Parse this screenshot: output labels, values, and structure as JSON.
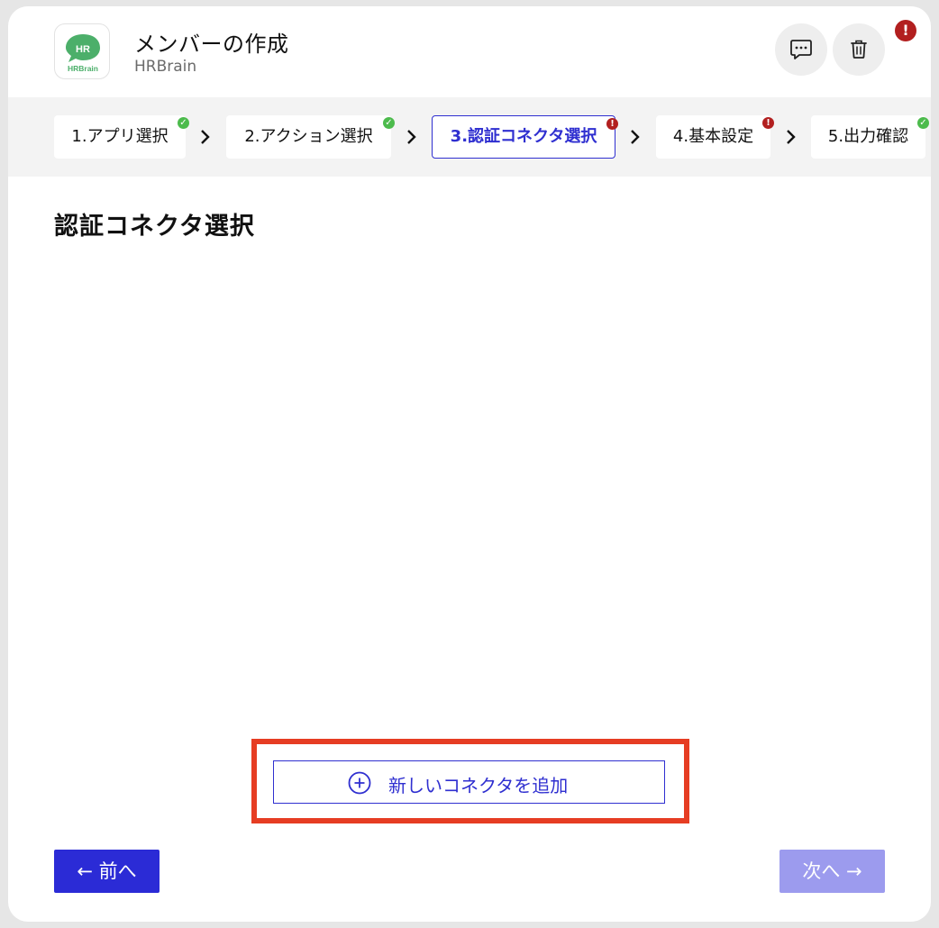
{
  "header": {
    "title": "メンバーの作成",
    "subtitle": "HRBrain",
    "logo_text_top": "HR",
    "logo_text_bottom": "HRBrain",
    "alert_badge": "!",
    "icons": [
      "comment-icon",
      "trash-icon"
    ]
  },
  "stepper": {
    "steps": [
      {
        "label": "1.アプリ選択",
        "status": "ok"
      },
      {
        "label": "2.アクション選択",
        "status": "ok"
      },
      {
        "label": "3.認証コネクタ選択",
        "status": "error",
        "active": true
      },
      {
        "label": "4.基本設定",
        "status": "error"
      },
      {
        "label": "5.出力確認",
        "status": "ok"
      }
    ],
    "ok_mark": "✓",
    "error_mark": "!"
  },
  "main": {
    "section_title": "認証コネクタ選択",
    "add_connector_label": "新しいコネクタを追加"
  },
  "footer": {
    "prev_label": "← 前へ",
    "next_label": "次へ →"
  },
  "colors": {
    "accent": "#2f2fd0",
    "success": "#4cbb4c",
    "error": "#b21f1f",
    "highlight": "#e63d23",
    "logo_green": "#4caf6a"
  }
}
